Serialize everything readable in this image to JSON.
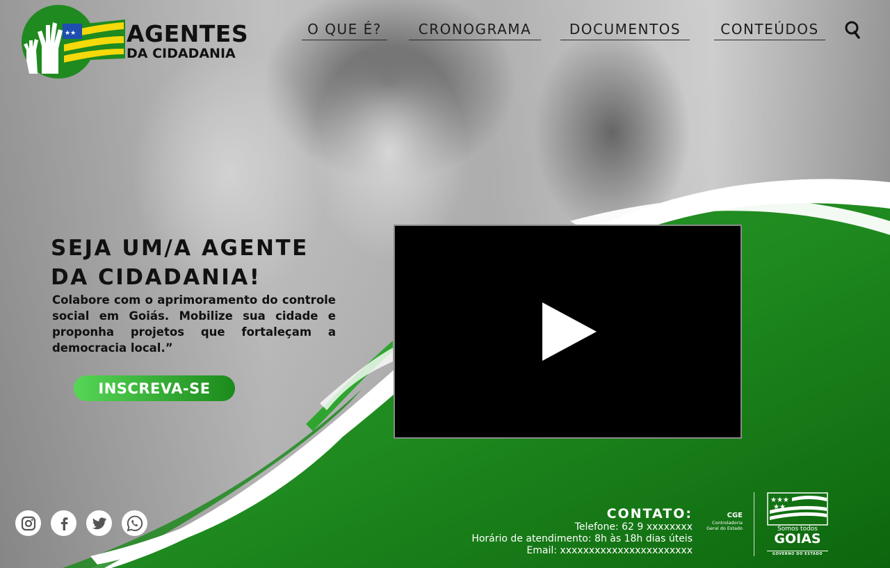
{
  "colors": {
    "brand_green": "#1f8a1f",
    "brand_green_dark": "#0e6a0e",
    "brand_yellow": "#f5d90a",
    "cta_light": "#56d656",
    "text_dark": "#111111",
    "video_bg": "#000000"
  },
  "header": {
    "logo": {
      "title": "AGENTES",
      "subtitle": "DA CIDADANIA",
      "icon": "hands-flag-logo"
    },
    "nav": [
      {
        "label": "O QUE É?"
      },
      {
        "label": "CRONOGRAMA"
      },
      {
        "label": "DOCUMENTOS"
      },
      {
        "label": "CONTEÚDOS"
      }
    ],
    "search_icon": "search-icon"
  },
  "hero": {
    "heading_line1": "SEJA UM/A AGENTE",
    "heading_line2": "DA CIDADANIA!",
    "body": "Colabore com o aprimoramento do controle social em Goiás. Mobilize sua cidade e proponha projetos que fortaleçam a democracia local.”",
    "cta_label": "INSCREVA-SE",
    "video": {
      "icon": "play-icon"
    }
  },
  "social": [
    {
      "icon": "instagram-icon"
    },
    {
      "icon": "facebook-icon"
    },
    {
      "icon": "twitter-icon"
    },
    {
      "icon": "whatsapp-icon"
    }
  ],
  "contact": {
    "title": "CONTATO:",
    "phone": "Telefone: 62 9 xxxxxxxx",
    "hours": "Horário de atendimento: 8h às 18h dias úteis",
    "email": "Email: xxxxxxxxxxxxxxxxxxxxxxx"
  },
  "footer_logos": {
    "cge_acronym": "CGE",
    "cge_name": "Controladoria Geral do Estado",
    "goias_tagline": "Somos todos",
    "goias_name": "GOIAS",
    "goias_sub": "GOVERNO DO ESTADO"
  }
}
